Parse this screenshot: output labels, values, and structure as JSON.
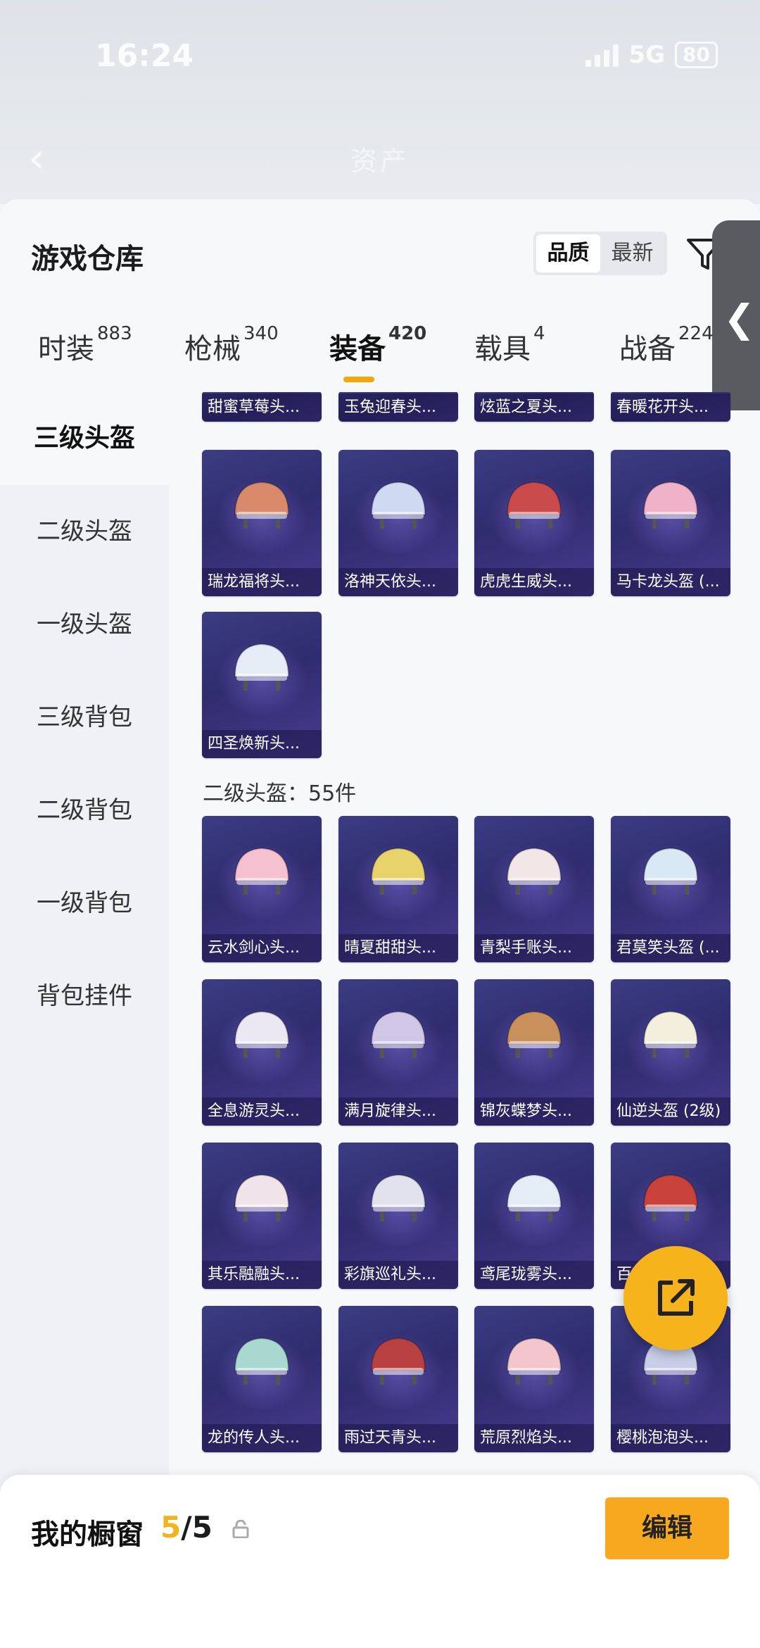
{
  "status_bar": {
    "time": "16:24",
    "network": "5G",
    "battery": "80"
  },
  "nav": {
    "title": "资产"
  },
  "sheet": {
    "title": "游戏仓库",
    "sort": {
      "quality": "品质",
      "latest": "最新"
    }
  },
  "tabs": [
    {
      "label": "时装",
      "count": "883"
    },
    {
      "label": "枪械",
      "count": "340"
    },
    {
      "label": "装备",
      "count": "420"
    },
    {
      "label": "载具",
      "count": "4"
    },
    {
      "label": "战备",
      "count": "224"
    }
  ],
  "sidebar": [
    {
      "label": "三级头盔"
    },
    {
      "label": "二级头盔"
    },
    {
      "label": "一级头盔"
    },
    {
      "label": "三级背包"
    },
    {
      "label": "二级背包"
    },
    {
      "label": "一级背包"
    },
    {
      "label": "背包挂件"
    }
  ],
  "items": {
    "top_partial": [
      "甜蜜草莓头...",
      "玉兔迎春头...",
      "炫蓝之夏头...",
      "春暖花开头..."
    ],
    "level3_row1": [
      "瑞龙福将头...",
      "洛神天依头...",
      "虎虎生威头...",
      "马卡龙头盔 (..."
    ],
    "level3_row2": [
      "四圣焕新头..."
    ],
    "level2_row1": [
      "云水剑心头...",
      "晴夏甜甜头...",
      "青梨手账头...",
      "君莫笑头盔 (..."
    ],
    "level2_row2": [
      "全息游灵头...",
      "满月旋律头...",
      "锦灰蝶梦头...",
      "仙逆头盔 (2级)"
    ],
    "level2_row3": [
      "其乐融融头...",
      "彩旗巡礼头...",
      "鸢尾珑雾头...",
      "百变纱华头..."
    ],
    "level2_row4": [
      "龙的传人头...",
      "雨过天青头...",
      "荒原烈焰头...",
      "樱桃泡泡头..."
    ]
  },
  "section": {
    "level2_title": "二级头盔：55件"
  },
  "bottom": {
    "title": "我的橱窗",
    "current": "5",
    "total": "/5",
    "edit": "编辑"
  },
  "colors": {
    "accent": "#f6b31b",
    "card_bg": "#2f2c6f"
  }
}
